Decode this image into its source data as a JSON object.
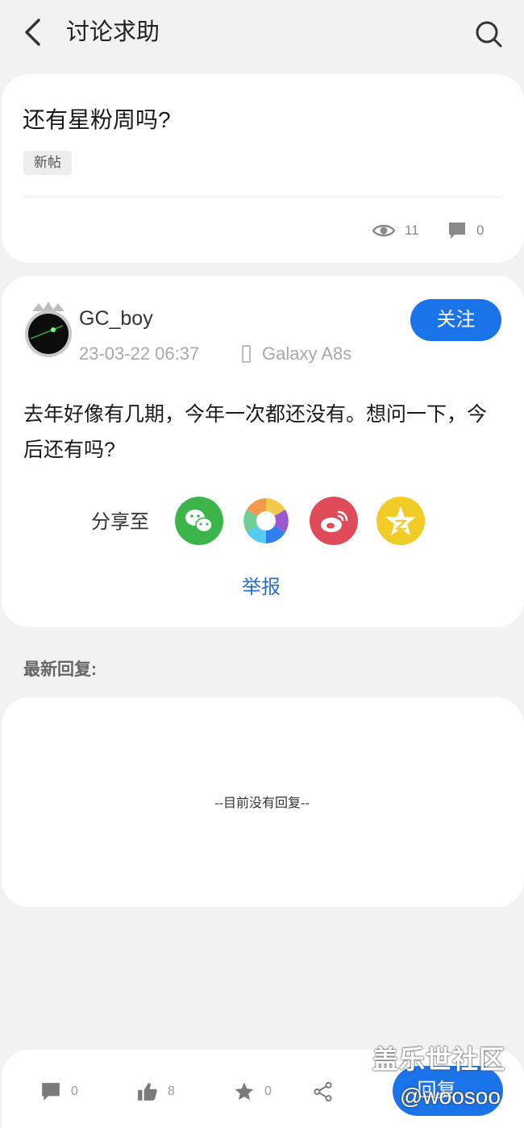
{
  "header": {
    "title": "讨论求助"
  },
  "post": {
    "title": "还有星粉周吗?",
    "tag": "新帖",
    "views": "11",
    "comments": "0",
    "author": {
      "name": "GC_boy",
      "date": "23-03-22 06:37",
      "device": "Galaxy A8s"
    },
    "follow_label": "关注",
    "body": "去年好像有几期，今年一次都还没有。想问一下，今后还有吗?",
    "share_label": "分享至",
    "share_targets": [
      "wechat-icon",
      "moments-icon",
      "weibo-icon",
      "qzone-icon"
    ],
    "report_label": "举报"
  },
  "replies": {
    "section_label": "最新回复:",
    "empty_text": "--目前没有回复--"
  },
  "bottom_bar": {
    "comments": "0",
    "likes": "8",
    "favorites": "0",
    "reply_label": "回复"
  },
  "watermark": {
    "line1": "盖乐世社区",
    "line2": "@woosoo"
  },
  "colors": {
    "accent": "#1a73e8",
    "link": "#2a6fcb",
    "background": "#f2f2f2"
  }
}
